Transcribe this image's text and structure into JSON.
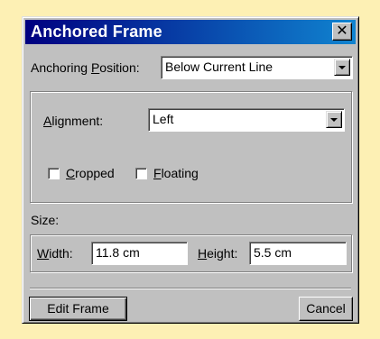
{
  "dialog": {
    "title": "Anchored Frame",
    "close_icon": "close-icon"
  },
  "anchoring": {
    "label_pre": "Anchoring ",
    "label_u": "P",
    "label_post": "osition:",
    "value": "Below Current Line"
  },
  "alignment": {
    "label_u": "A",
    "label_post": "lignment:",
    "value": "Left"
  },
  "options": {
    "cropped": {
      "label_u": "C",
      "label_post": "ropped",
      "checked": false
    },
    "floating": {
      "label_u": "F",
      "label_post": "loating",
      "checked": false
    }
  },
  "size": {
    "label": "Size:",
    "width_label_u": "W",
    "width_label_post": "idth:",
    "width_value": "11.8 cm",
    "height_label_u": "H",
    "height_label_post": "eight:",
    "height_value": "5.5 cm"
  },
  "buttons": {
    "edit_frame": "Edit Frame",
    "cancel": "Cancel"
  }
}
